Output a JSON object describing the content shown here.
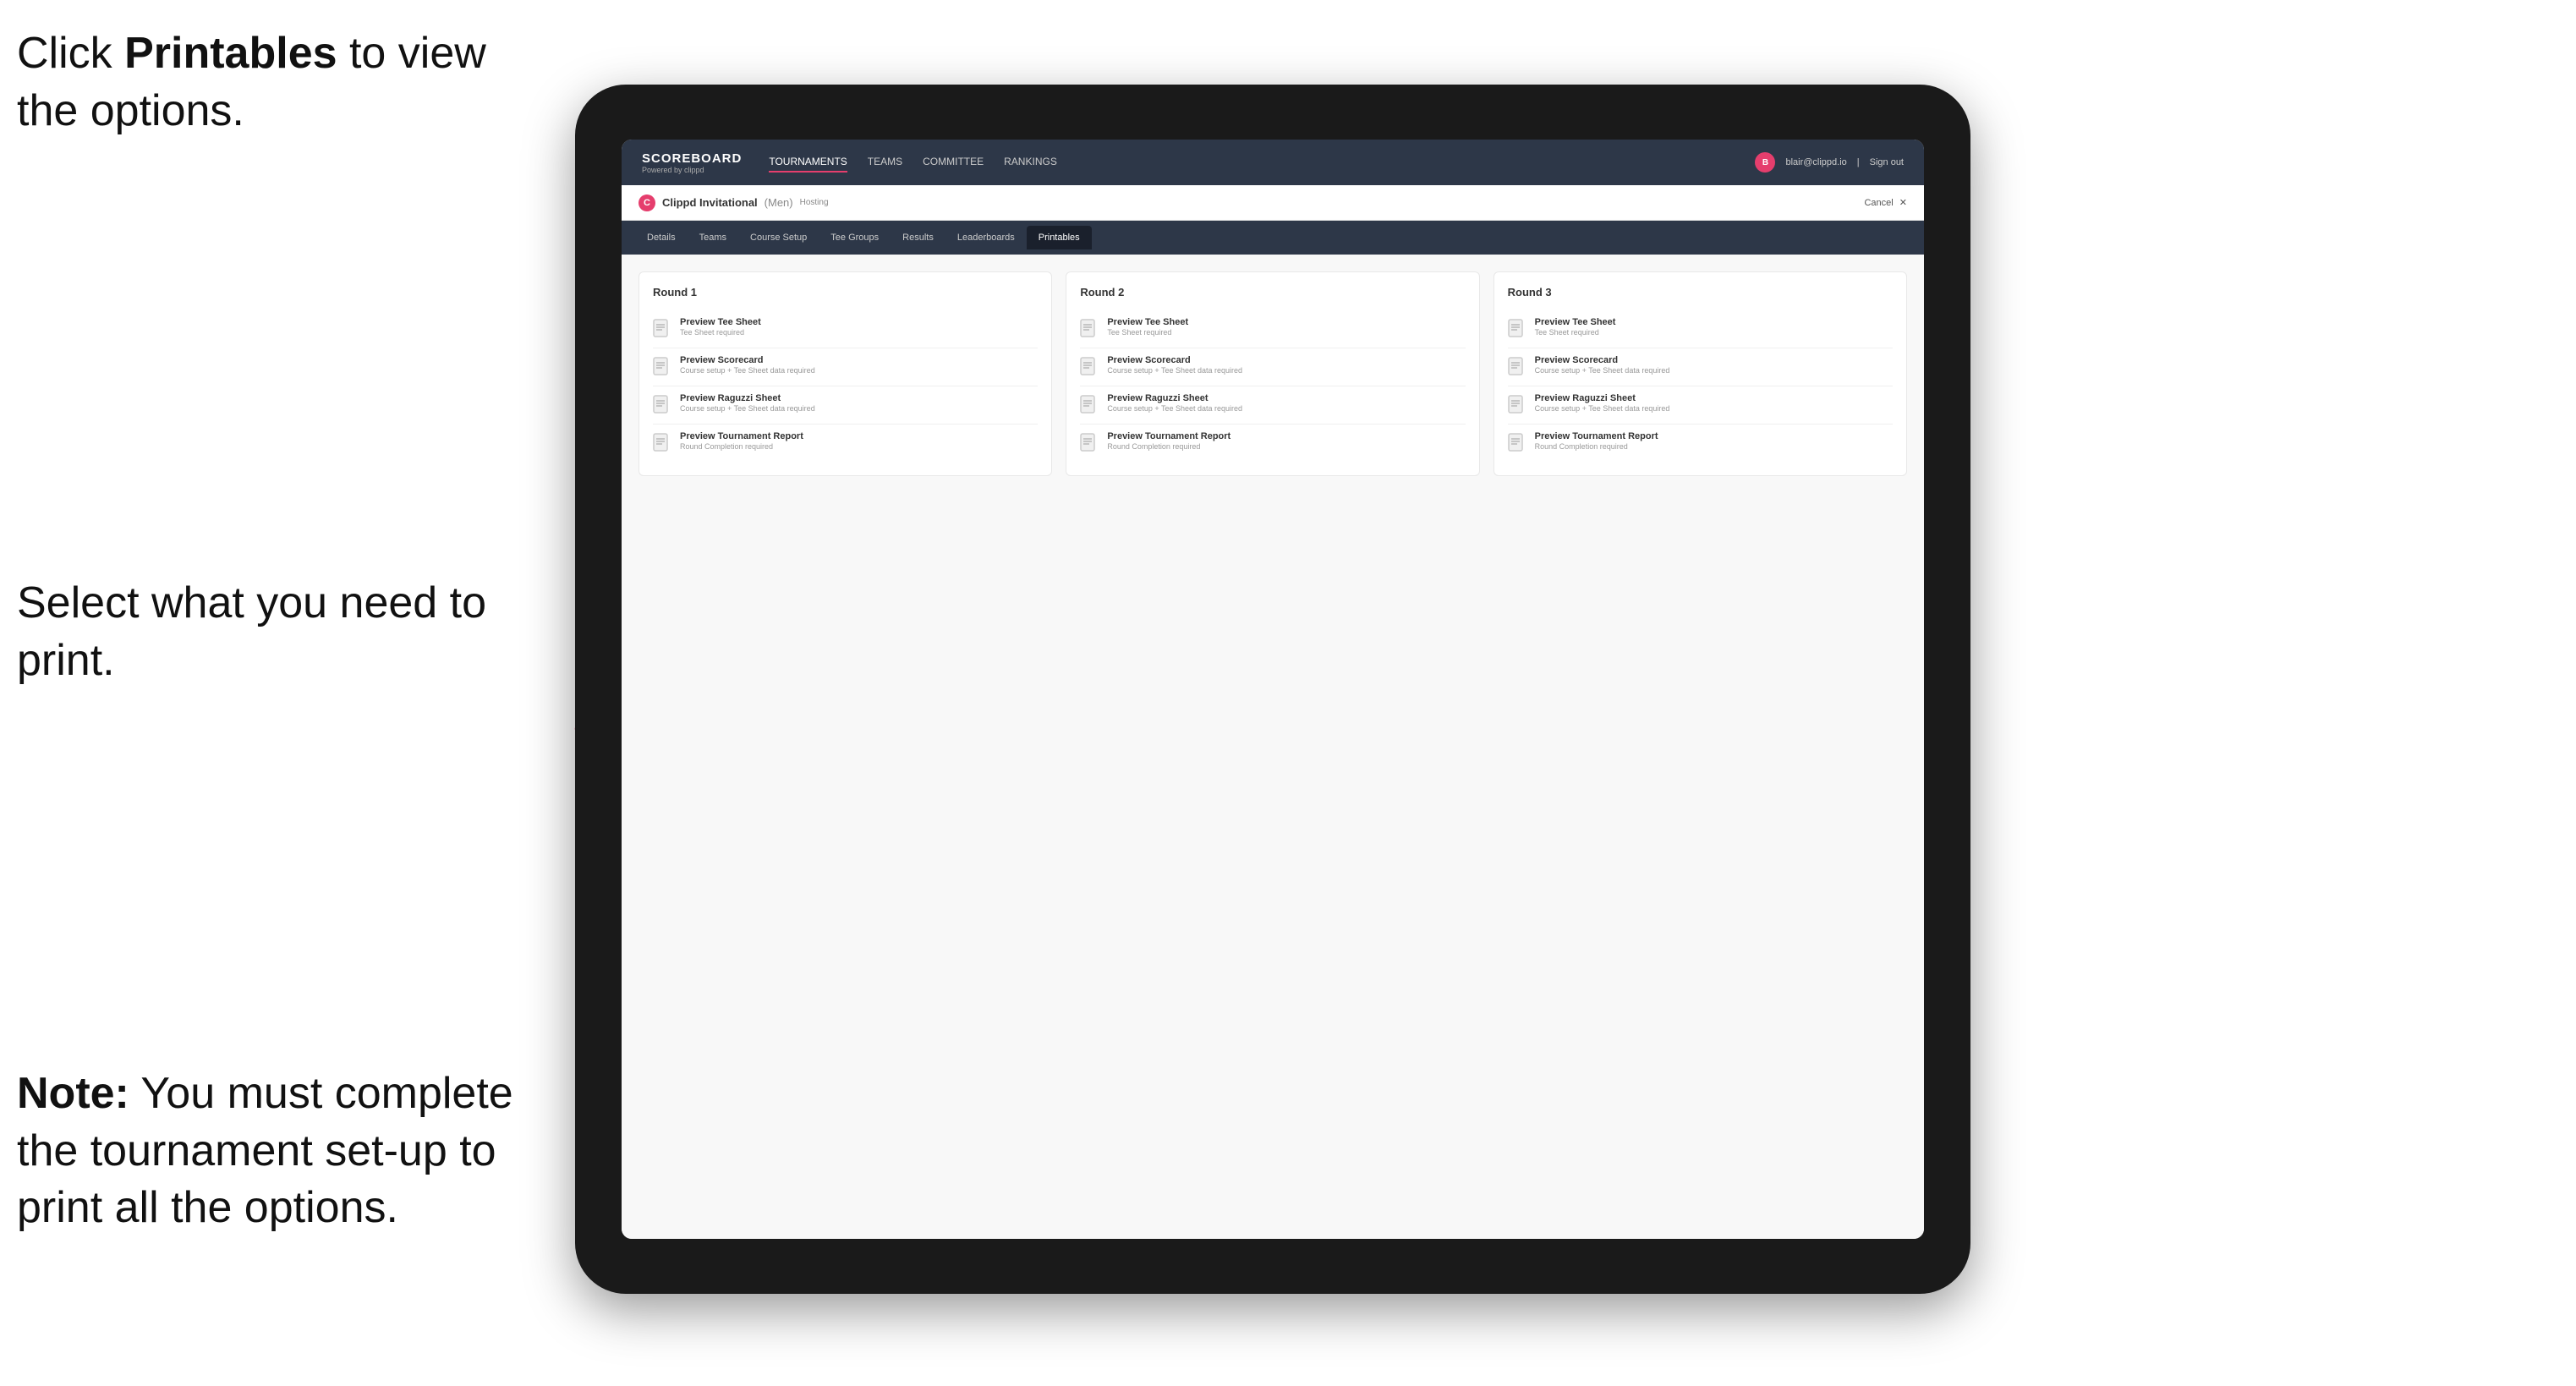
{
  "annotations": {
    "top": {
      "text_before": "Click ",
      "bold": "Printables",
      "text_after": " to view the options."
    },
    "middle": {
      "text": "Select what you need to print."
    },
    "bottom": {
      "text_before": "",
      "bold": "Note:",
      "text_after": " You must complete the tournament set-up to print all the options."
    }
  },
  "nav": {
    "brand": "SCOREBOARD",
    "brand_sub": "Powered by clippd",
    "links": [
      "TOURNAMENTS",
      "TEAMS",
      "COMMITTEE",
      "RANKINGS"
    ],
    "active_link": "TOURNAMENTS",
    "user_email": "blair@clippd.io",
    "sign_out": "Sign out"
  },
  "sub_nav": {
    "tournament_name": "Clippd Invitational",
    "bracket": "(Men)",
    "status": "Hosting",
    "cancel": "Cancel"
  },
  "tabs": [
    "Details",
    "Teams",
    "Course Setup",
    "Tee Groups",
    "Results",
    "Leaderboards",
    "Printables"
  ],
  "active_tab": "Printables",
  "rounds": [
    {
      "title": "Round 1",
      "items": [
        {
          "title": "Preview Tee Sheet",
          "subtitle": "Tee Sheet required"
        },
        {
          "title": "Preview Scorecard",
          "subtitle": "Course setup + Tee Sheet data required"
        },
        {
          "title": "Preview Raguzzi Sheet",
          "subtitle": "Course setup + Tee Sheet data required"
        },
        {
          "title": "Preview Tournament Report",
          "subtitle": "Round Completion required"
        }
      ]
    },
    {
      "title": "Round 2",
      "items": [
        {
          "title": "Preview Tee Sheet",
          "subtitle": "Tee Sheet required"
        },
        {
          "title": "Preview Scorecard",
          "subtitle": "Course setup + Tee Sheet data required"
        },
        {
          "title": "Preview Raguzzi Sheet",
          "subtitle": "Course setup + Tee Sheet data required"
        },
        {
          "title": "Preview Tournament Report",
          "subtitle": "Round Completion required"
        }
      ]
    },
    {
      "title": "Round 3",
      "items": [
        {
          "title": "Preview Tee Sheet",
          "subtitle": "Tee Sheet required"
        },
        {
          "title": "Preview Scorecard",
          "subtitle": "Course setup + Tee Sheet data required"
        },
        {
          "title": "Preview Raguzzi Sheet",
          "subtitle": "Course setup + Tee Sheet data required"
        },
        {
          "title": "Preview Tournament Report",
          "subtitle": "Round Completion required"
        }
      ]
    }
  ]
}
